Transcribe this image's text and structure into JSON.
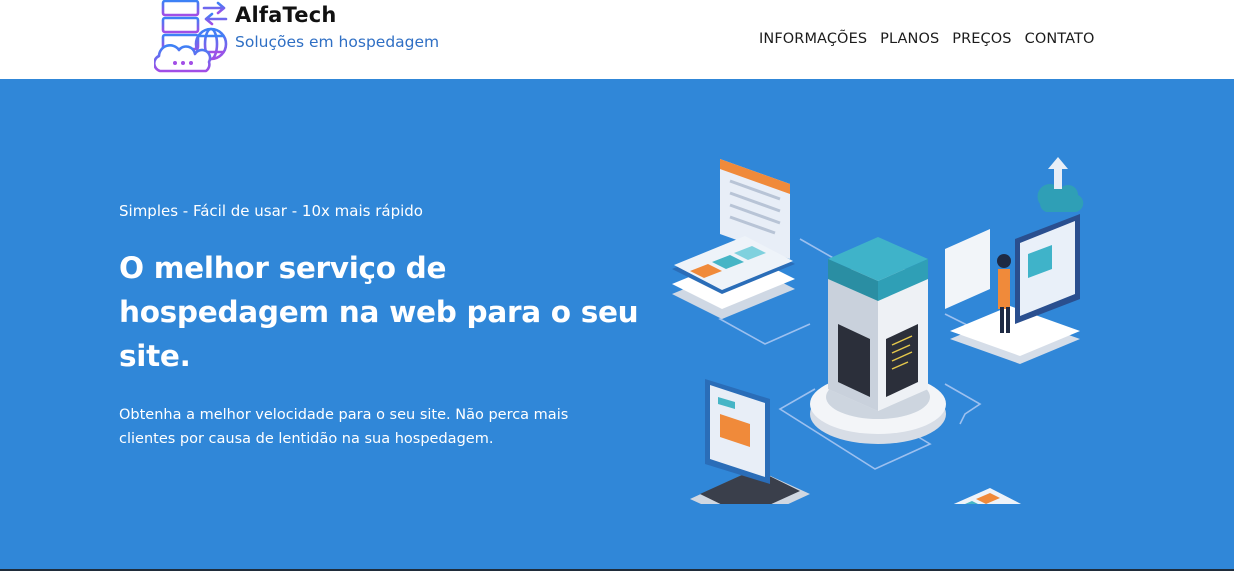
{
  "header": {
    "brand_name": "AlfaTech",
    "brand_tagline": "Soluções em hospedagem",
    "logo_icon": "server-cloud-logo-icon",
    "nav": [
      {
        "label": "INFORMAÇÕES"
      },
      {
        "label": "PLANOS"
      },
      {
        "label": "PREÇOS"
      },
      {
        "label": "CONTATO"
      }
    ]
  },
  "hero": {
    "kicker": "Simples - Fácil de usar - 10x mais rápido",
    "headline": "O melhor serviço de hospedagem na web para o seu site.",
    "description": "Obtenha a melhor velocidade para o seu site. Não perca mais clientes por causa de lentidão na sua hospedagem.",
    "illustration": "isometric-server-hosting-illustration"
  },
  "colors": {
    "hero_background": "#3087d8",
    "header_background": "#ffffff",
    "tagline": "#2f6fc4",
    "logo_gradient_start": "#3b82f6",
    "logo_gradient_end": "#a24ee6"
  }
}
